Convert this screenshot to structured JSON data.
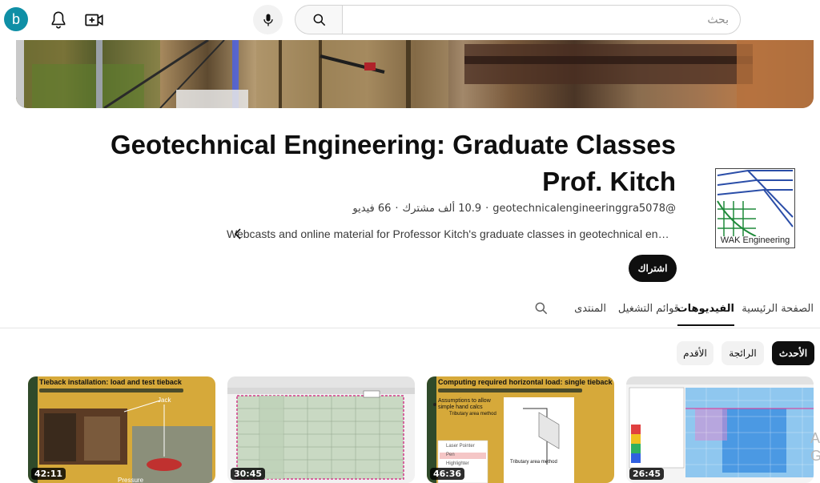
{
  "header": {
    "avatar_letter": "b",
    "search_placeholder": "بحث",
    "icons": [
      "bell-icon",
      "create-video-icon",
      "mic-icon",
      "search-icon"
    ]
  },
  "channel": {
    "title": "Geotechnical Engineering: Graduate Classes Prof. Kitch",
    "handle": "@geotechnicalengineeringgra5078",
    "subscribers": "10.9 ألف مشترك",
    "videos": "66 فيديو",
    "separator": "·",
    "description": "Webcasts and online material for Professor Kitch's graduate classes in geotechnical engin…",
    "subscribe_label": "اشتراك",
    "logo_text": "WAK Engineering"
  },
  "tabs": [
    {
      "label": "الصفحة الرئيسية",
      "active": false
    },
    {
      "label": "الفيديوهات",
      "active": true
    },
    {
      "label": "قوائم التشغيل",
      "active": false
    },
    {
      "label": "المنتدى",
      "active": false
    }
  ],
  "chips": [
    {
      "label": "الأحدث",
      "selected": true
    },
    {
      "label": "الرائجة",
      "selected": false
    },
    {
      "label": "الأقدم",
      "selected": false
    }
  ],
  "videos": [
    {
      "duration": "42:11",
      "slide_title": "Tieback installation:  load and test tieback",
      "labels": [
        "Jack",
        "Pressure"
      ]
    },
    {
      "duration": "30:45",
      "slide_title": ""
    },
    {
      "duration": "46:36",
      "slide_title": "Computing required horizontal load: single tieback",
      "labels": [
        "Assumptions to allow simple hand calcs",
        "Tributary area method",
        "Laser Pointer",
        "Pen",
        "Highlighter",
        "Tributary area method"
      ]
    },
    {
      "duration": "26:45",
      "slide_title": ""
    }
  ],
  "edge_text": [
    "A",
    "G"
  ],
  "colors": {
    "accent": "#0f0f0f",
    "avatar": "#0f8fa6",
    "slide_gold": "#d6a93a",
    "slide_green": "#2f4a2a"
  }
}
